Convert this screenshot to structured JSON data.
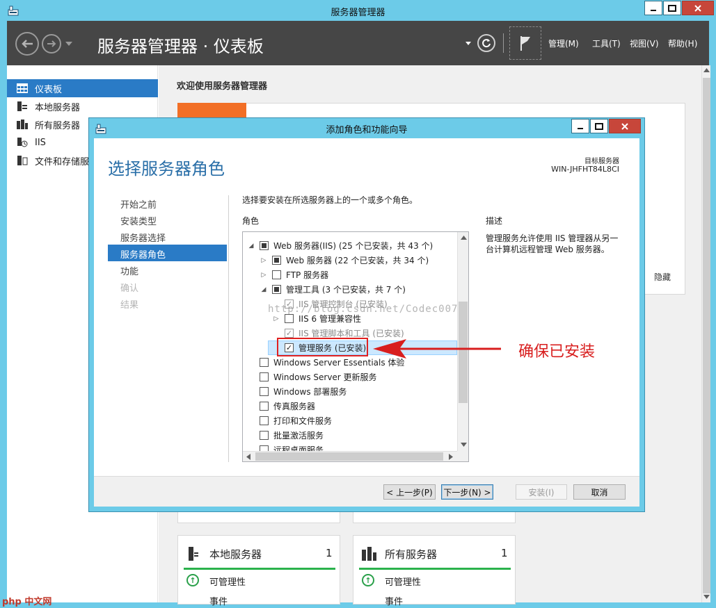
{
  "app": {
    "title": "服务器管理器",
    "breadcrumb": "服务器管理器 · 仪表板",
    "menus": [
      "管理(M)",
      "工具(T)",
      "视图(V)",
      "帮助(H)"
    ]
  },
  "sidebar": {
    "items": [
      {
        "label": "仪表板",
        "icon": "dashboard-icon",
        "active": true
      },
      {
        "label": "本地服务器",
        "icon": "server-icon"
      },
      {
        "label": "所有服务器",
        "icon": "servers-icon"
      },
      {
        "label": "IIS",
        "icon": "iis-icon"
      },
      {
        "label": "文件和存储服",
        "icon": "storage-icon"
      }
    ]
  },
  "dashboard": {
    "welcome": "欢迎使用服务器管理器",
    "hide": "隐藏",
    "tiles": [
      {
        "title": "本地服务器",
        "count": "1",
        "manageability": "可管理性",
        "events": "事件"
      },
      {
        "title": "所有服务器",
        "count": "1",
        "manageability": "可管理性",
        "events": "事件"
      }
    ]
  },
  "wizard": {
    "title": "添加角色和功能向导",
    "heading": "选择服务器角色",
    "target_label": "目标服务器",
    "target_name": "WIN-JHFHT84L8CI",
    "steps": [
      {
        "label": "开始之前",
        "state": "normal"
      },
      {
        "label": "安装类型",
        "state": "normal"
      },
      {
        "label": "服务器选择",
        "state": "normal"
      },
      {
        "label": "服务器角色",
        "state": "active"
      },
      {
        "label": "功能",
        "state": "normal"
      },
      {
        "label": "确认",
        "state": "disabled"
      },
      {
        "label": "结果",
        "state": "disabled"
      }
    ],
    "instructions": "选择要安装在所选服务器上的一个或多个角色。",
    "roles_label": "角色",
    "description_label": "描述",
    "description": "管理服务允许使用 IIS 管理器从另一台计算机远程管理 Web 服务器。",
    "roles": [
      {
        "label": "Web 服务器(IIS) (25 个已安装，共 43 个)",
        "indent": 0,
        "expander": "open",
        "check": "partial"
      },
      {
        "label": "Web 服务器 (22 个已安装，共 34 个)",
        "indent": 1,
        "expander": "closed",
        "check": "partial"
      },
      {
        "label": "FTP 服务器",
        "indent": 1,
        "expander": "closed",
        "check": "none"
      },
      {
        "label": "管理工具 (3 个已安装，共 7 个)",
        "indent": 1,
        "expander": "open",
        "check": "partial"
      },
      {
        "label": "IIS 管理控制台 (已安装)",
        "indent": 2,
        "expander": "",
        "check": "grey"
      },
      {
        "label": "IIS 6 管理兼容性",
        "indent": 2,
        "expander": "closed",
        "check": "none"
      },
      {
        "label": "IIS 管理脚本和工具 (已安装)",
        "indent": 2,
        "expander": "",
        "check": "grey"
      },
      {
        "label": "管理服务 (已安装)",
        "indent": 2,
        "expander": "",
        "check": "checked",
        "selected": true
      },
      {
        "label": "Windows Server Essentials 体验",
        "indent": 0,
        "expander": "",
        "check": "none"
      },
      {
        "label": "Windows Server 更新服务",
        "indent": 0,
        "expander": "",
        "check": "none"
      },
      {
        "label": "Windows 部署服务",
        "indent": 0,
        "expander": "",
        "check": "none"
      },
      {
        "label": "传真服务器",
        "indent": 0,
        "expander": "",
        "check": "none"
      },
      {
        "label": "打印和文件服务",
        "indent": 0,
        "expander": "",
        "check": "none"
      },
      {
        "label": "批量激活服务",
        "indent": 0,
        "expander": "",
        "check": "none"
      },
      {
        "label": "远程桌面服务",
        "indent": 0,
        "expander": "",
        "check": "none"
      }
    ],
    "buttons": {
      "prev": "< 上一步(P)",
      "next": "下一步(N) >",
      "install": "安装(I)",
      "cancel": "取消"
    }
  },
  "overlay": {
    "annotation": "确保已安装",
    "watermark": "http://blog.csdn.net/Codec007",
    "logo": "php 中文网"
  },
  "colors": {
    "titlebar": "#6ccbe8",
    "header": "#464646",
    "accent": "#2a7bc6",
    "heading": "#2a6fa8",
    "annotation": "#d81e1e",
    "orange": "#f26f26",
    "green": "#2bb24c"
  }
}
